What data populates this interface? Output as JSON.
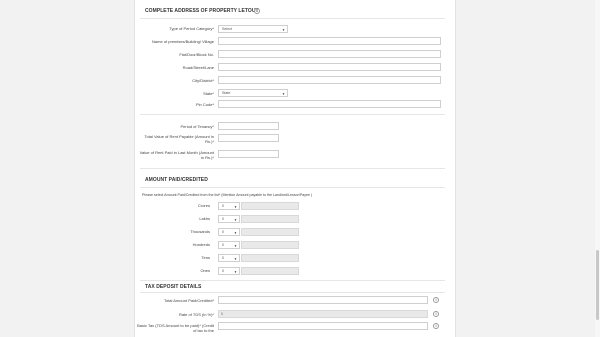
{
  "address_section": {
    "title": "COMPLETE ADDRESS OF PROPERTY LETOUT",
    "fields": {
      "type_label": "Type of Period Category*",
      "type_value": "Select",
      "name_label": "Name of premises/Building/ Village",
      "flat_label": "Flat/Door/Block No.",
      "road_label": "Road/Street/Lane",
      "city_label": "City/District*",
      "state_label": "State*",
      "state_value": "State",
      "pin_label": "Pin Code*"
    }
  },
  "tenancy": {
    "period_label": "Period of Tenancy*",
    "total_rent_label": "Total Value of Rent Payable (Amount in Rs.)*",
    "last_month_label": "Value of Rent Paid in Last Month (Amount in Rs.)*"
  },
  "amount_section": {
    "title": "AMOUNT PAID/CREDITED",
    "note": "Please select Amount Paid/Credited from the list* (Mention Amount payable to the Landlord/Lessor/Payee )",
    "rows": [
      {
        "label": "Crores",
        "value": "0"
      },
      {
        "label": "Lakhs",
        "value": "0"
      },
      {
        "label": "Thousands",
        "value": "0"
      },
      {
        "label": "Hundreds",
        "value": "0"
      },
      {
        "label": "Tens",
        "value": "0"
      },
      {
        "label": "Ones",
        "value": "0"
      }
    ]
  },
  "tax_section": {
    "title": "TAX DEPOSIT DETAILS",
    "total_label": "Total Amount Paid/Credited*",
    "rate_label": "Rate of TDS (in %)*",
    "rate_value": "5",
    "basic_label": "Basic Tax (TDS Amount to be paid)* (Credit of tax to the"
  },
  "icons": {
    "info": "i",
    "caret": "▼"
  }
}
